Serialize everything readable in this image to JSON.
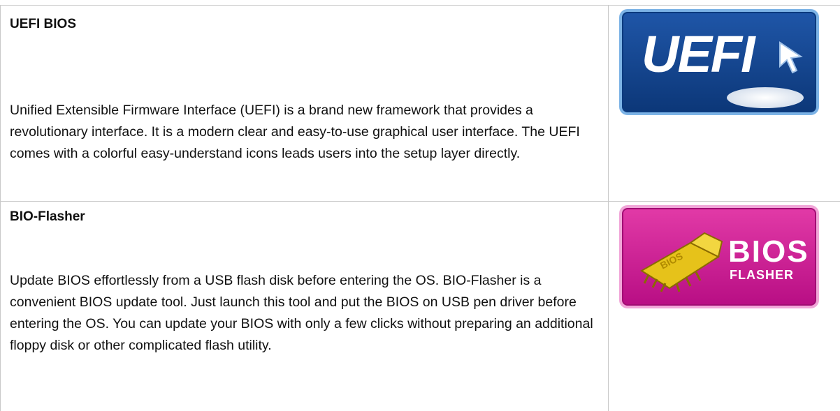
{
  "sections": [
    {
      "title": "UEFI BIOS",
      "description": "Unified Extensible Firmware Interface (UEFI) is a brand new framework that provides a revolutionary interface. It is a modern clear and easy-to-use graphical user interface. The UEFI comes with a colorful easy-understand icons leads users into the setup layer directly.",
      "logo": {
        "text": "UEFI",
        "icon": "uefi-logo-icon"
      }
    },
    {
      "title": "BIO-Flasher",
      "description": "Update BIOS effortlessly from a USB flash disk before entering the OS. BIO-Flasher is a convenient BIOS update tool. Just launch this tool and put the BIOS on USB pen driver before entering the OS. You can update your BIOS with only a few clicks without preparing an additional floppy disk or other complicated flash utility.",
      "logo": {
        "text": "BIOS",
        "subtext": "FLASHER",
        "chip_label": "BIOS",
        "icon": "bios-flasher-logo-icon"
      }
    }
  ],
  "colors": {
    "uefi_blue": "#1f56a8",
    "bios_magenta": "#d0239a",
    "border_gray": "#c9c9c9"
  }
}
